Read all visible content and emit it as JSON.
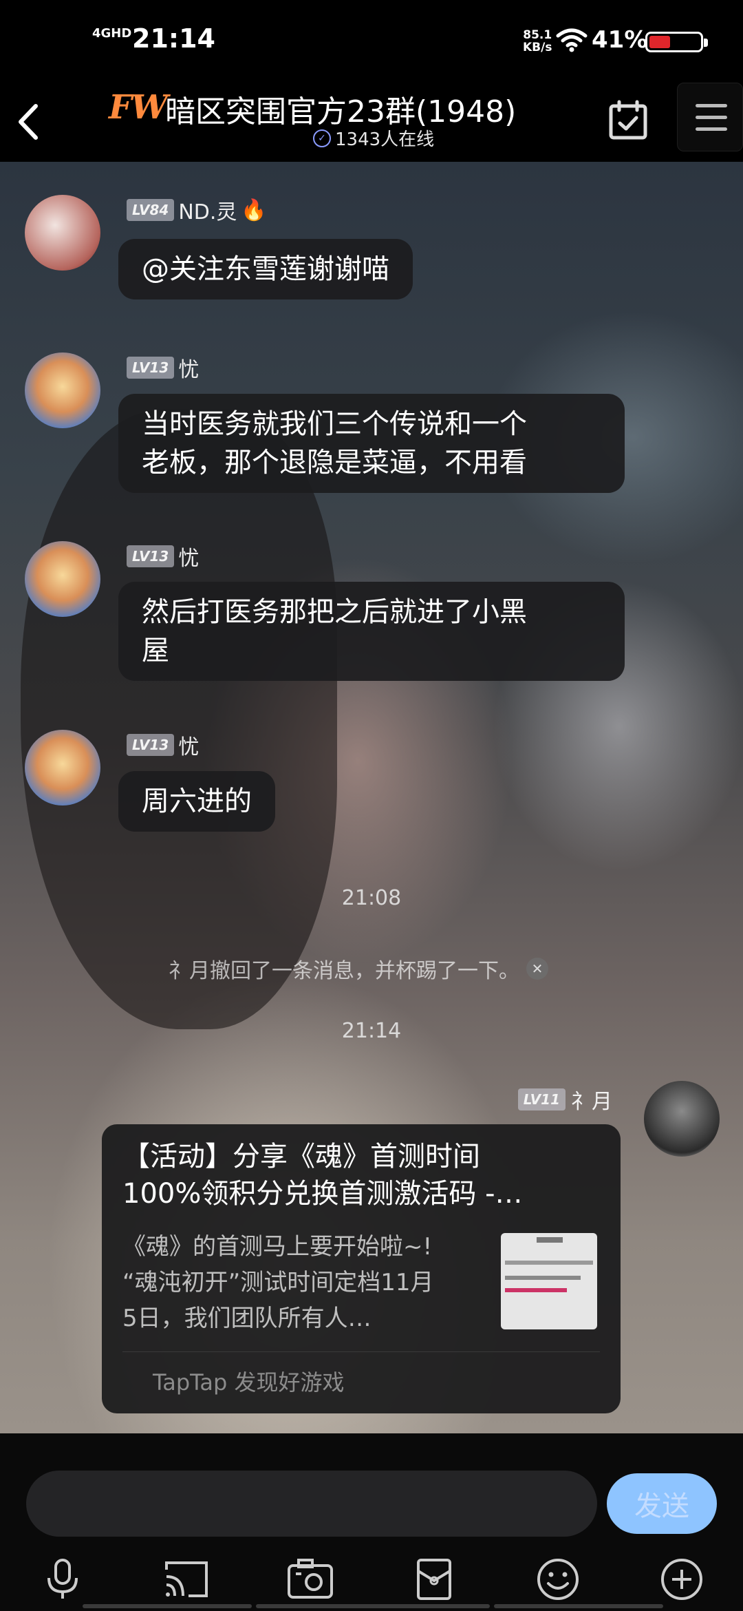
{
  "status_bar": {
    "network": "4GHD",
    "time": "21:14",
    "speed_value": "85.1",
    "speed_unit": "KB/s",
    "battery": "41%",
    "battery_level": 0.41
  },
  "header": {
    "logo": "FW",
    "title": "暗区突围官方23群(1948)",
    "online": "1343人在线"
  },
  "messages": [
    {
      "level": "LV84",
      "sender": "ND.灵",
      "emoji": "🔥",
      "text": "@关注东雪莲谢谢喵"
    },
    {
      "level": "LV13",
      "sender": "忧",
      "text_line1": "当时医务就我们三个传说和一个",
      "text_line2": "老板，那个退隐是菜逼，不用看"
    },
    {
      "level": "LV13",
      "sender": "忧",
      "text_line1": "然后打医务那把之后就进了小黑",
      "text_line2": "屋"
    },
    {
      "level": "LV13",
      "sender": "忧",
      "text": "周六进的"
    }
  ],
  "time_1": "21:08",
  "recall_notice": "礻月撤回了一条消息，并杯踢了一下。",
  "time_2": "21:14",
  "own_message": {
    "level": "LV11",
    "sender": "礻月",
    "card_title_line1": "【活动】分享《魂》首测时间",
    "card_title_line2": "100%领积分兑换首测激活码 -…",
    "card_desc_line1": "《魂》的首测马上要开始啦~!",
    "card_desc_line2": "“魂沌初开”测试时间定档11月",
    "card_desc_line3": "5日，我们团队所有人…",
    "card_source": "TapTap 发现好游戏"
  },
  "input": {
    "placeholder": "",
    "send_label": "发送"
  },
  "toolbar": [
    "mic-icon",
    "cast-icon",
    "photo-icon",
    "redpacket-icon",
    "emoji-icon",
    "plus-icon"
  ],
  "colors": {
    "accent": "#8ec4ff",
    "logo": "#ff8a3d",
    "battery": "#e0262b"
  }
}
